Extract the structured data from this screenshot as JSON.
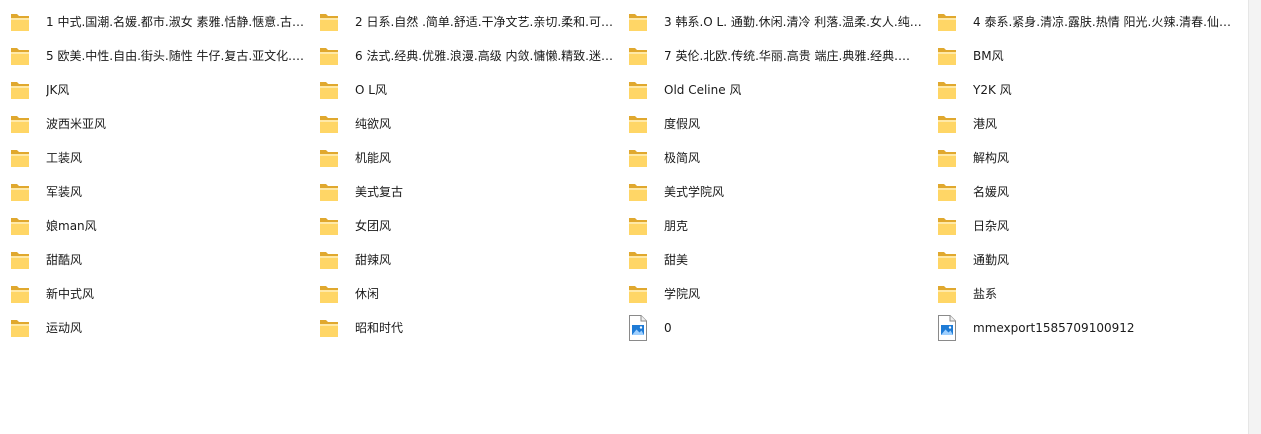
{
  "items": [
    {
      "name": "1 中式.国潮.名媛.都市.淑女  素雅.恬静.惬意.古…",
      "type": "folder"
    },
    {
      "name": "2 日系.自然 .简单.舒适.干净文艺.亲切.柔和.可…",
      "type": "folder"
    },
    {
      "name": "3 韩系.O L. 通勤.休闲.清冷 利落.温柔.女人.纯…",
      "type": "folder"
    },
    {
      "name": "4 泰系.紧身.清凉.露肤.热情 阳光.火辣.清春.仙…",
      "type": "folder"
    },
    {
      "name": "5 欧美.中性.自由.街头.随性 牛仔.复古.亚文化.…",
      "type": "folder"
    },
    {
      "name": "6 法式.经典.优雅.浪漫.高级  内敛.慵懒.精致.迷…",
      "type": "folder"
    },
    {
      "name": "7 英伦.北欧.传统.华丽.高贵   端庄.典雅.经典.…",
      "type": "folder"
    },
    {
      "name": "BM风",
      "type": "folder"
    },
    {
      "name": "JK风",
      "type": "folder"
    },
    {
      "name": "O L风",
      "type": "folder"
    },
    {
      "name": "Old Celine 风",
      "type": "folder"
    },
    {
      "name": "Y2K 风",
      "type": "folder"
    },
    {
      "name": "波西米亚风",
      "type": "folder"
    },
    {
      "name": "纯欲风",
      "type": "folder"
    },
    {
      "name": "度假风",
      "type": "folder"
    },
    {
      "name": "港风",
      "type": "folder"
    },
    {
      "name": "工装风",
      "type": "folder"
    },
    {
      "name": "机能风",
      "type": "folder"
    },
    {
      "name": "极简风",
      "type": "folder"
    },
    {
      "name": "解构风",
      "type": "folder"
    },
    {
      "name": "军装风",
      "type": "folder"
    },
    {
      "name": "美式复古",
      "type": "folder"
    },
    {
      "name": "美式学院风",
      "type": "folder"
    },
    {
      "name": "名媛风",
      "type": "folder"
    },
    {
      "name": "娘man风",
      "type": "folder"
    },
    {
      "name": "女团风",
      "type": "folder"
    },
    {
      "name": "朋克",
      "type": "folder"
    },
    {
      "name": "日杂风",
      "type": "folder"
    },
    {
      "name": "甜酷风",
      "type": "folder"
    },
    {
      "name": "甜辣风",
      "type": "folder"
    },
    {
      "name": "甜美",
      "type": "folder"
    },
    {
      "name": "通勤风",
      "type": "folder"
    },
    {
      "name": "新中式风",
      "type": "folder"
    },
    {
      "name": "休闲",
      "type": "folder"
    },
    {
      "name": "学院风",
      "type": "folder"
    },
    {
      "name": "盐系",
      "type": "folder"
    },
    {
      "name": "运动风",
      "type": "folder"
    },
    {
      "name": "昭和时代",
      "type": "folder"
    },
    {
      "name": "0",
      "type": "image"
    },
    {
      "name": "mmexport1585709100912",
      "type": "image"
    }
  ],
  "colors": {
    "folder_back": "#e0a82e",
    "folder_front": "#ffd666",
    "folder_highlight": "#ffe9a8",
    "image_accent": "#1e7bd6",
    "text": "#1a1a1a"
  }
}
